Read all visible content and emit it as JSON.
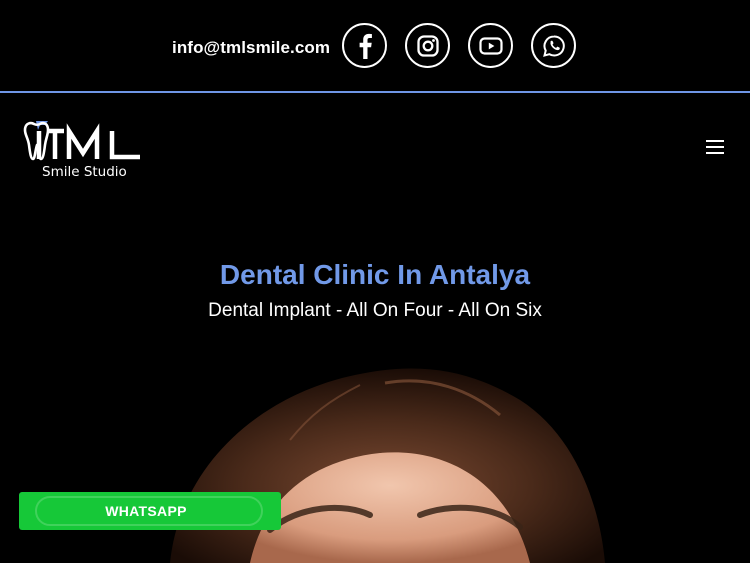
{
  "header": {
    "email": "info@tmlsmile.com",
    "social": [
      {
        "name": "facebook",
        "icon": "facebook-icon"
      },
      {
        "name": "instagram",
        "icon": "instagram-icon"
      },
      {
        "name": "youtube",
        "icon": "youtube-icon"
      },
      {
        "name": "whatsapp",
        "icon": "whatsapp-icon"
      }
    ],
    "accent_color": "#6f96e6"
  },
  "nav": {
    "logo": {
      "mark": "TML",
      "tagline": "Smile Studio"
    },
    "menu_icon": "hamburger-icon"
  },
  "hero": {
    "title": "Dental Clinic In Antalya",
    "subtitle": "Dental Implant - All On Four - All On Six",
    "title_color": "#7199e8"
  },
  "floating": {
    "whatsapp_label": "WHATSAPP",
    "whatsapp_color": "#16c838"
  }
}
